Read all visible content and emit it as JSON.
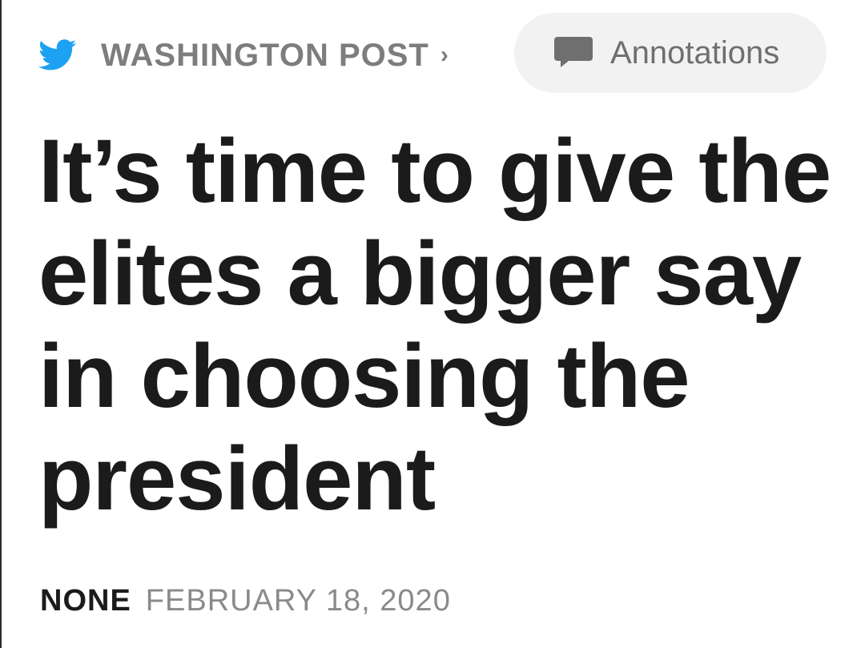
{
  "header": {
    "source_name": "WASHINGTON POST",
    "source_chevron": "›",
    "source_icon": "twitter-bird-icon",
    "annotations_label": "Annotations",
    "annotations_icon": "comment-icon"
  },
  "article": {
    "headline": "It’s time to give the elites a bigger say in choosing the president",
    "author": "NONE",
    "date": "FEBRUARY 18, 2020"
  },
  "colors": {
    "icon_blue": "#1da1f2",
    "muted_gray": "#7d7d7d",
    "headline_black": "#1b1b1b",
    "pill_background": "#f2f2f2"
  }
}
